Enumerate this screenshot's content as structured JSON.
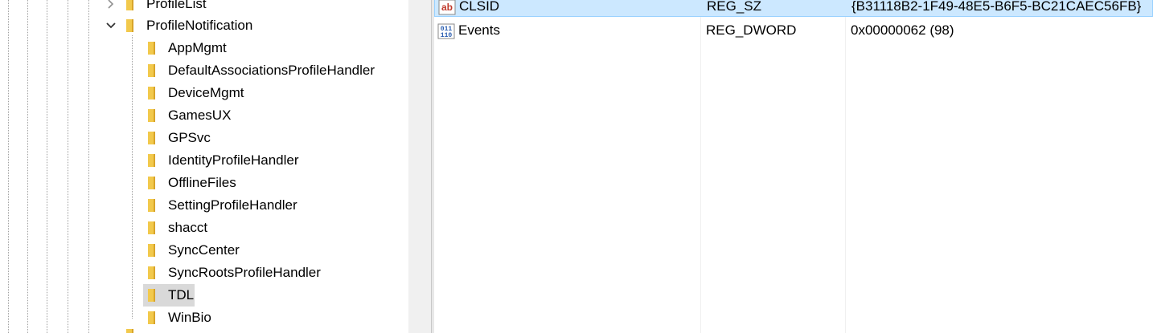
{
  "tree": {
    "partial_top_label": "ProfileList",
    "parent": {
      "label": "ProfileNotification",
      "expanded": true
    },
    "children": [
      {
        "label": "AppMgmt"
      },
      {
        "label": "DefaultAssociationsProfileHandler"
      },
      {
        "label": "DeviceMgmt"
      },
      {
        "label": "GamesUX"
      },
      {
        "label": "GPSvc"
      },
      {
        "label": "IdentityProfileHandler"
      },
      {
        "label": "OfflineFiles"
      },
      {
        "label": "SettingProfileHandler"
      },
      {
        "label": "shacct"
      },
      {
        "label": "SyncCenter"
      },
      {
        "label": "SyncRootsProfileHandler"
      },
      {
        "label": "TDL",
        "selected": true
      },
      {
        "label": "WinBio"
      }
    ],
    "icons": {
      "folder": "folder-icon",
      "expand": "chevron-right-icon",
      "collapse": "chevron-down-icon"
    }
  },
  "values": [
    {
      "name": "CLSID",
      "type": "REG_SZ",
      "data": "{B31118B2-1F49-48E5-B6F5-BC21CAEC56FB}",
      "icon": "string-value-icon",
      "selected": true
    },
    {
      "name": "Events",
      "type": "REG_DWORD",
      "data": "0x00000062 (98)",
      "icon": "binary-value-icon",
      "selected": false
    }
  ],
  "colors": {
    "selected_row": "#cce8ff",
    "selected_tree": "#d9d9d9",
    "folder": "#f2c94c"
  }
}
